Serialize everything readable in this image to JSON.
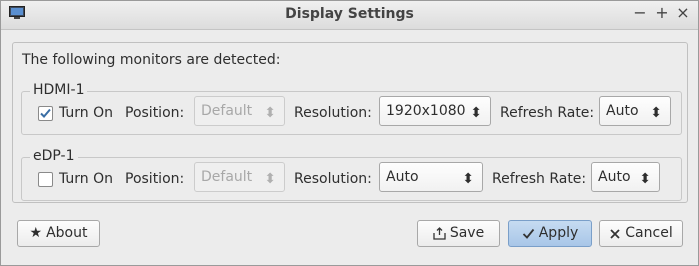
{
  "window": {
    "title": "Display Settings",
    "controls": {
      "minimize": "−",
      "maximize": "+",
      "close": "×"
    }
  },
  "detected_label": "The following monitors are detected:",
  "monitors": [
    {
      "name": "HDMI-1",
      "turn_on_label": "Turn On",
      "turn_on_checked": true,
      "position_label": "Position:",
      "position_value": "Default",
      "resolution_label": "Resolution:",
      "resolution_value": "1920x1080",
      "refresh_label": "Refresh Rate:",
      "refresh_value": "Auto"
    },
    {
      "name": "eDP-1",
      "turn_on_label": "Turn On",
      "turn_on_checked": false,
      "position_label": "Position:",
      "position_value": "Default",
      "resolution_label": "Resolution:",
      "resolution_value": "Auto",
      "refresh_label": "Refresh Rate:",
      "refresh_value": "Auto"
    }
  ],
  "buttons": {
    "about": {
      "label": "About",
      "icon": "star-icon"
    },
    "save": {
      "label": "Save",
      "icon": "save-icon"
    },
    "apply": {
      "label": "Apply",
      "icon": "checkmark-icon"
    },
    "cancel": {
      "label": "Cancel",
      "icon": "close-icon"
    }
  },
  "spin_arrow": "⬍",
  "colors": {
    "accent": "#a8c6e8",
    "check_mark": "#3a6ea5"
  }
}
